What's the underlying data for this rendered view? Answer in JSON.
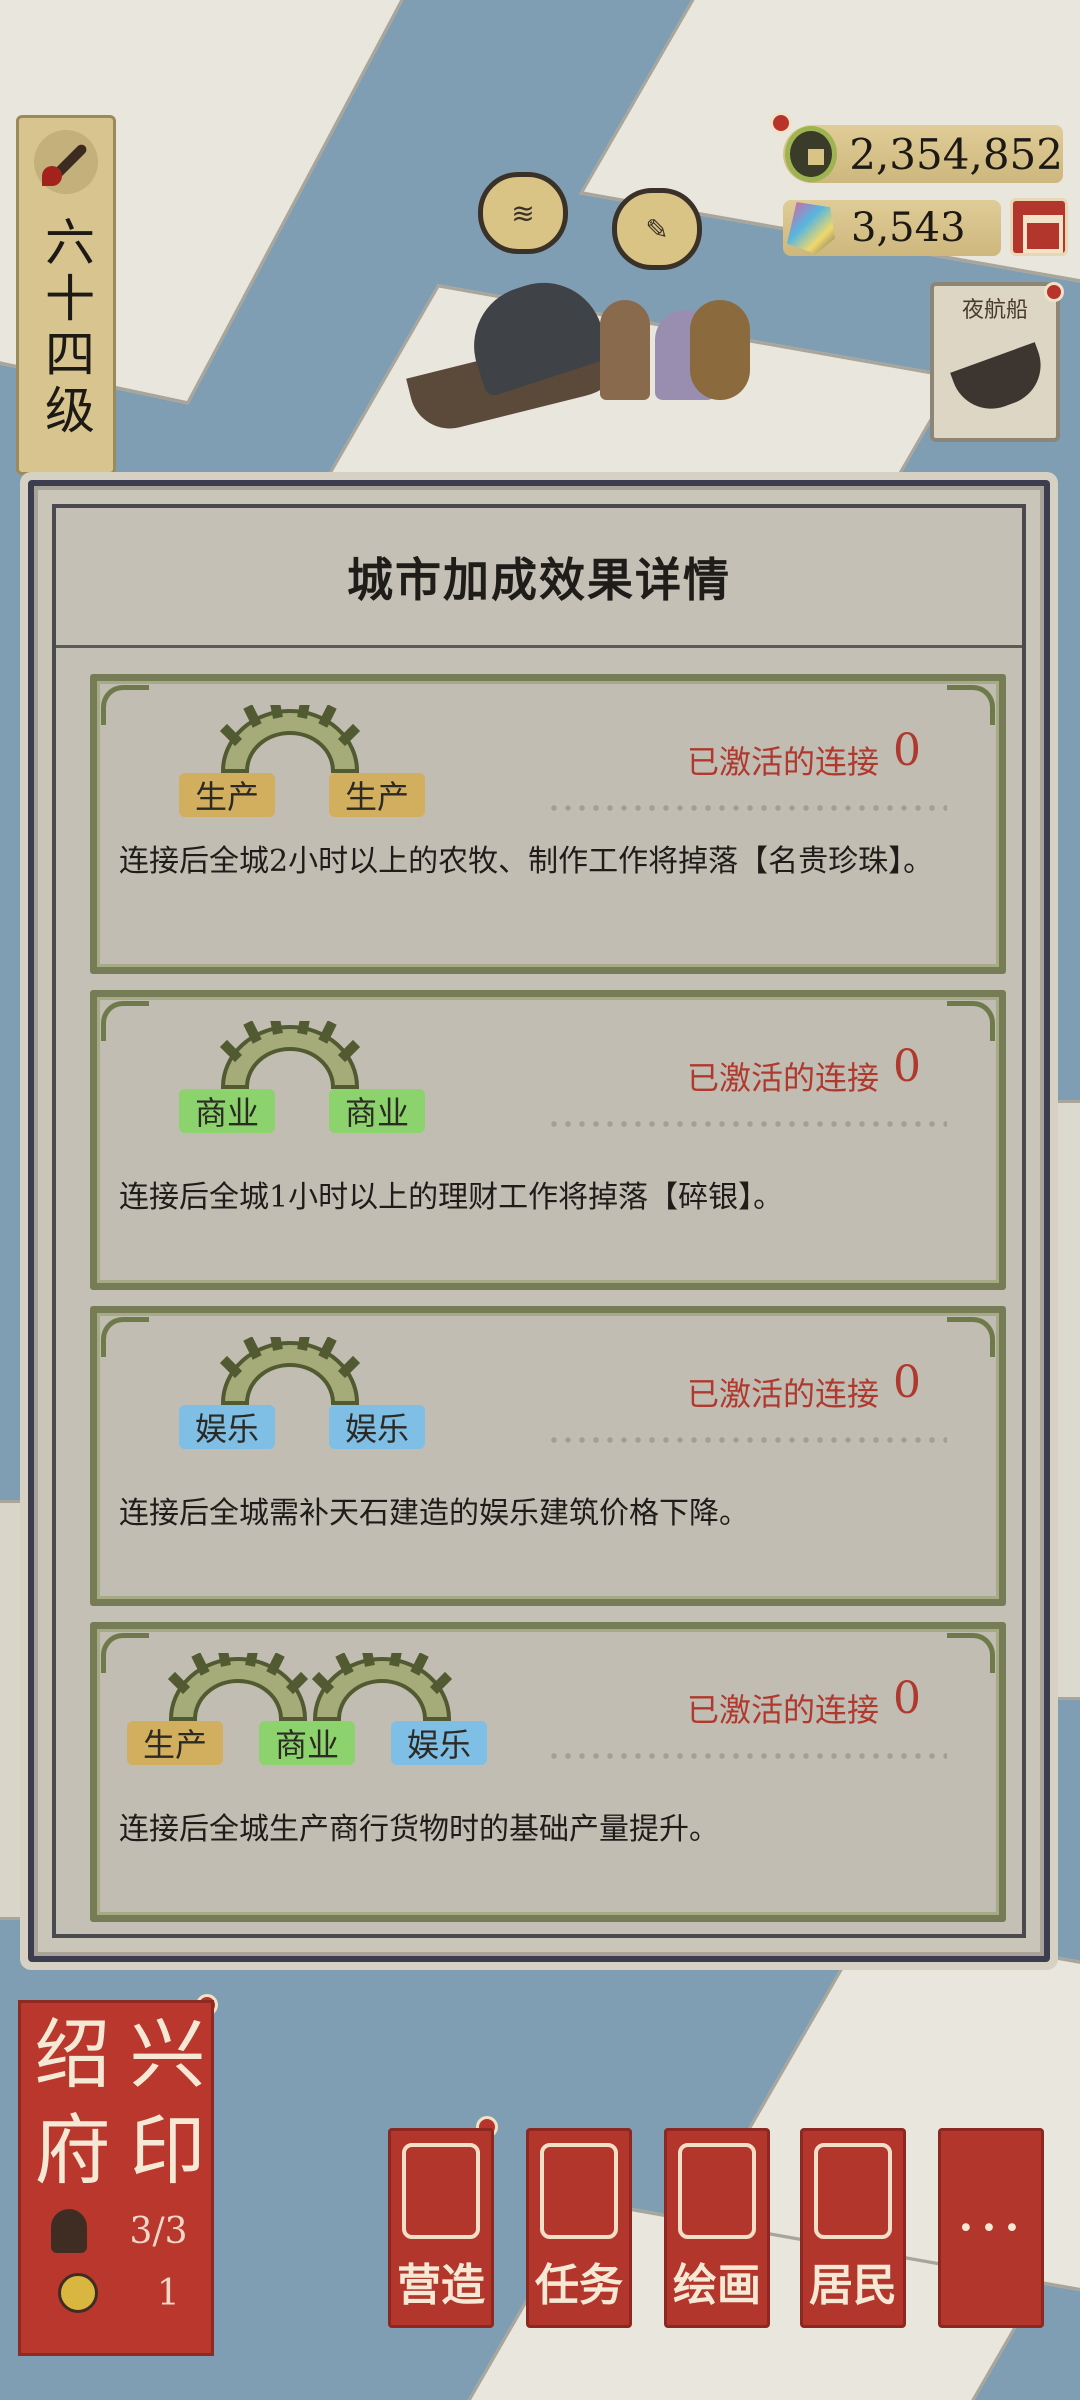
{
  "player": {
    "level_text": "六十四级"
  },
  "currency": {
    "coins": "2,354,852",
    "gems": "3,543"
  },
  "side_event": {
    "night_boat_label": "夜航船"
  },
  "dialog": {
    "title": "城市加成效果详情",
    "cards": [
      {
        "tags": [
          "生产",
          "生产"
        ],
        "active_label": "已激活的连接",
        "active_count": "0",
        "description": "连接后全城2小时以上的农牧、制作工作将掉落【名贵珍珠】。"
      },
      {
        "tags": [
          "商业",
          "商业"
        ],
        "active_label": "已激活的连接",
        "active_count": "0",
        "description": "连接后全城1小时以上的理财工作将掉落【碎银】。"
      },
      {
        "tags": [
          "娱乐",
          "娱乐"
        ],
        "active_label": "已激活的连接",
        "active_count": "0",
        "description": "连接后全城需补天石建造的娱乐建筑价格下降。"
      },
      {
        "tags": [
          "生产",
          "商业",
          "娱乐"
        ],
        "active_label": "已激活的连接",
        "active_count": "0",
        "description": "连接后全城生产商行货物时的基础产量提升。"
      }
    ]
  },
  "seal": {
    "chars": [
      "绍",
      "兴",
      "府",
      "印"
    ],
    "residents": "3/3",
    "workers": "1"
  },
  "menu": {
    "build": "营造",
    "tasks": "任务",
    "painting": "绘画",
    "residents": "居民",
    "more": "···"
  },
  "colors": {
    "tag_production": "#d2ae5f",
    "tag_business": "#8dd36d",
    "tag_entertainment": "#7fbfe6",
    "accent_red": "#b3362c",
    "active_text": "#b0392f"
  }
}
